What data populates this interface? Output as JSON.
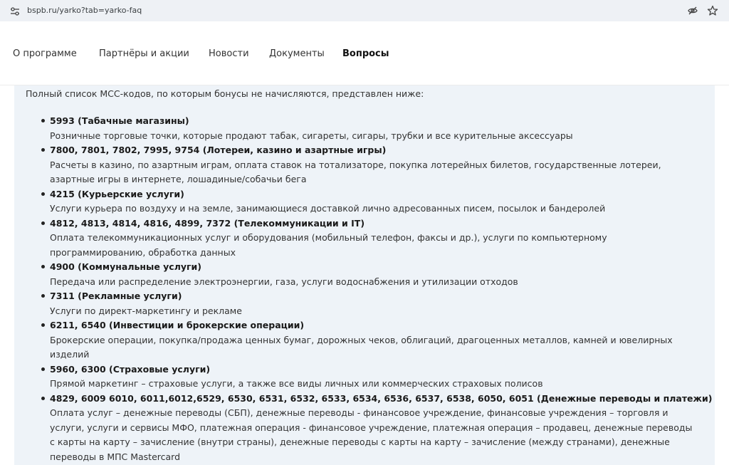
{
  "browser": {
    "url": "bspb.ru/yarko?tab=yarko-faq"
  },
  "nav": {
    "items": [
      {
        "label": "О программе",
        "active": false
      },
      {
        "label": "Партнёры и акции",
        "active": false
      },
      {
        "label": "Новости",
        "active": false
      },
      {
        "label": "Документы",
        "active": false
      },
      {
        "label": "Вопросы",
        "active": true
      }
    ]
  },
  "content": {
    "intro": "Полный список МСС-кодов, по которым бонусы не начисляются, представлен ниже:",
    "items": [
      {
        "title": "5993 (Табачные магазины)",
        "desc": "Розничные торговые точки, которые продают табак, сигареты, сигары, трубки и все курительные аксессуары"
      },
      {
        "title": "7800, 7801, 7802, 7995, 9754 (Лотереи, казино и азартные игры)",
        "desc": "Расчеты в казино, по азартным играм, оплата ставок на тотализаторе, покупка лотерейных билетов, государственные лотереи, азартные игры в интернете, лошадиные/собачьи бега"
      },
      {
        "title": "4215 (Курьерские услуги)",
        "desc": "Услуги курьера по воздуху и на земле, занимающиеся доставкой лично адресованных писем, посылок и бандеролей"
      },
      {
        "title": "4812, 4813, 4814, 4816, 4899, 7372 (Телекоммуникации и IT)",
        "desc": "Оплата телекоммуникационных услуг и оборудования (мобильный телефон, факсы и др.), услуги по компьютерному программированию, обработка данных"
      },
      {
        "title": "4900 (Коммунальные услуги)",
        "desc": "Передача или распределение электроэнергии, газа, услуги водоснабжения и утилизации отходов"
      },
      {
        "title": "7311 (Рекламные услуги)",
        "desc": "Услуги по директ-маркетингу и рекламе"
      },
      {
        "title": "6211, 6540 (Инвестиции и брокерские операции)",
        "desc": "Брокерские операции, покупка/продажа ценных бумаг, дорожных чеков, облигаций, драгоценных металлов, камней и ювелирных изделий"
      },
      {
        "title": "5960, 6300 (Страховые услуги)",
        "desc": "Прямой маркетинг – страховые услуги, а также все виды личных или коммерческих страховых полисов"
      },
      {
        "title": "4829, 6009 6010, 6011,6012,6529, 6530, 6531, 6532, 6533, 6534, 6536, 6537, 6538, 6050, 6051 (Денежные переводы и платежи)",
        "desc": "Оплата услуг – денежные переводы (СБП), денежные переводы - финансовое учреждение, финансовые учреждения – торговля и услуги, услуги и сервисы МФО, платежная операция - финансовое учреждение, платежная операция – продавец, денежные переводы с карты на карту – зачисление (внутри страны), денежные переводы с карты на карту – зачисление (между странами), денежные переводы в МПС Mastercard"
      }
    ]
  },
  "icons": {
    "site_info": "tune-icon",
    "tracking": "eye-off-icon",
    "bookmark": "star-icon"
  }
}
